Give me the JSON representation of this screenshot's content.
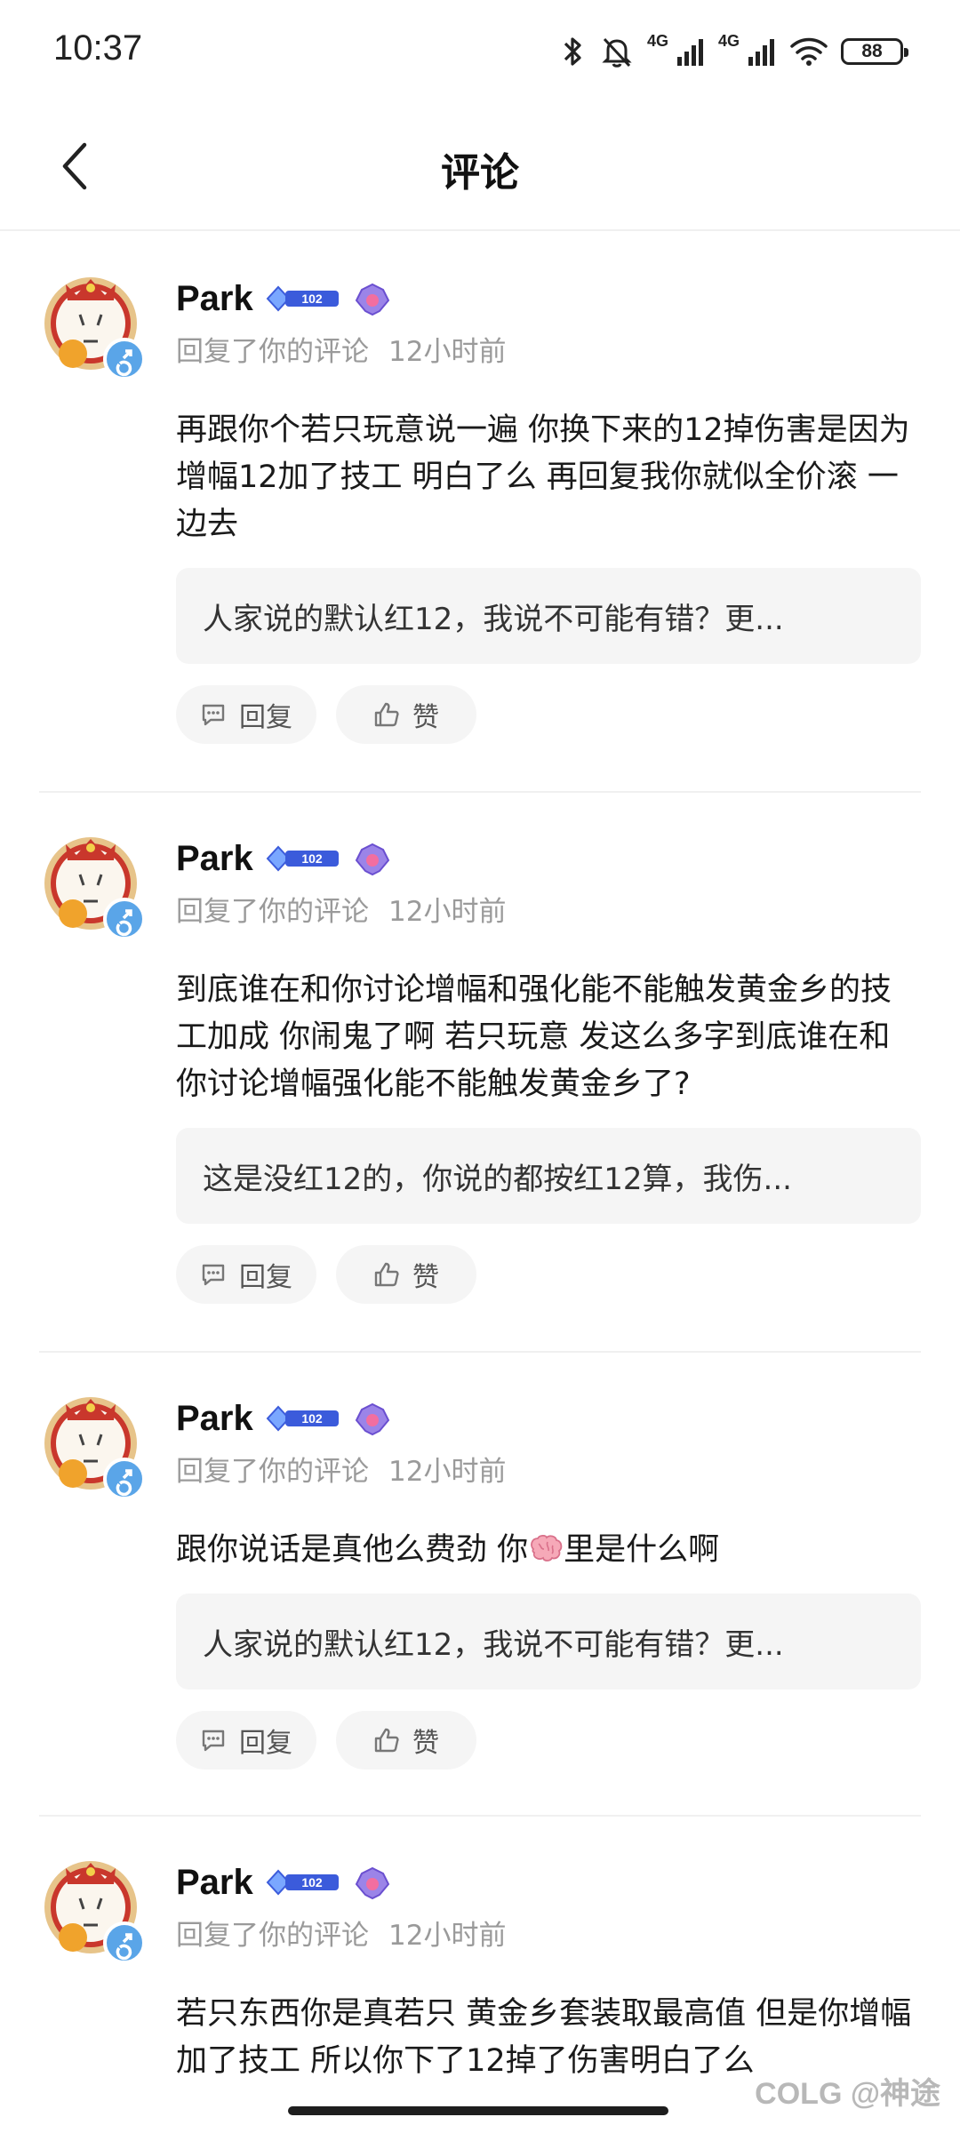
{
  "status_bar": {
    "time": "10:37",
    "net1": "4G",
    "net2": "4G",
    "battery": "88"
  },
  "header": {
    "title": "评论"
  },
  "comments": [
    {
      "user": "Park",
      "level": "102",
      "action": "回复了你的评论",
      "time": "12小时前",
      "content": "再跟你个若只玩意说一遍 你换下来的12掉伤害是因为增幅12加了技工  明白了么 再回复我你就似全价滚 一边去",
      "quote": "人家说的默认红12，我说不可能有错？更...",
      "reply_label": "回复",
      "like_label": "赞"
    },
    {
      "user": "Park",
      "level": "102",
      "action": "回复了你的评论",
      "time": "12小时前",
      "content": "到底谁在和你讨论增幅和强化能不能触发黄金乡的技工加成 你闹鬼了啊 若只玩意  发这么多字到底谁在和你讨论增幅强化能不能触发黄金乡了?",
      "quote": "这是没红12的，你说的都按红12算，我伤...",
      "reply_label": "回复",
      "like_label": "赞"
    },
    {
      "user": "Park",
      "level": "102",
      "action": "回复了你的评论",
      "time": "12小时前",
      "content_before": "跟你说话是真他么费劲 你",
      "content_after": "里是什么啊",
      "quote": "人家说的默认红12，我说不可能有错？更...",
      "reply_label": "回复",
      "like_label": "赞"
    },
    {
      "user": "Park",
      "level": "102",
      "action": "回复了你的评论",
      "time": "12小时前",
      "content": "若只东西你是真若只 黄金乡套装取最高值 但是你增幅加了技工 所以你下了12掉了伤害明白了么"
    }
  ],
  "watermark": "COLG @神途",
  "colors": {
    "accent": "#3b5bdb",
    "quote_bg": "#f5f5f5",
    "meta": "#9a9a9a"
  }
}
